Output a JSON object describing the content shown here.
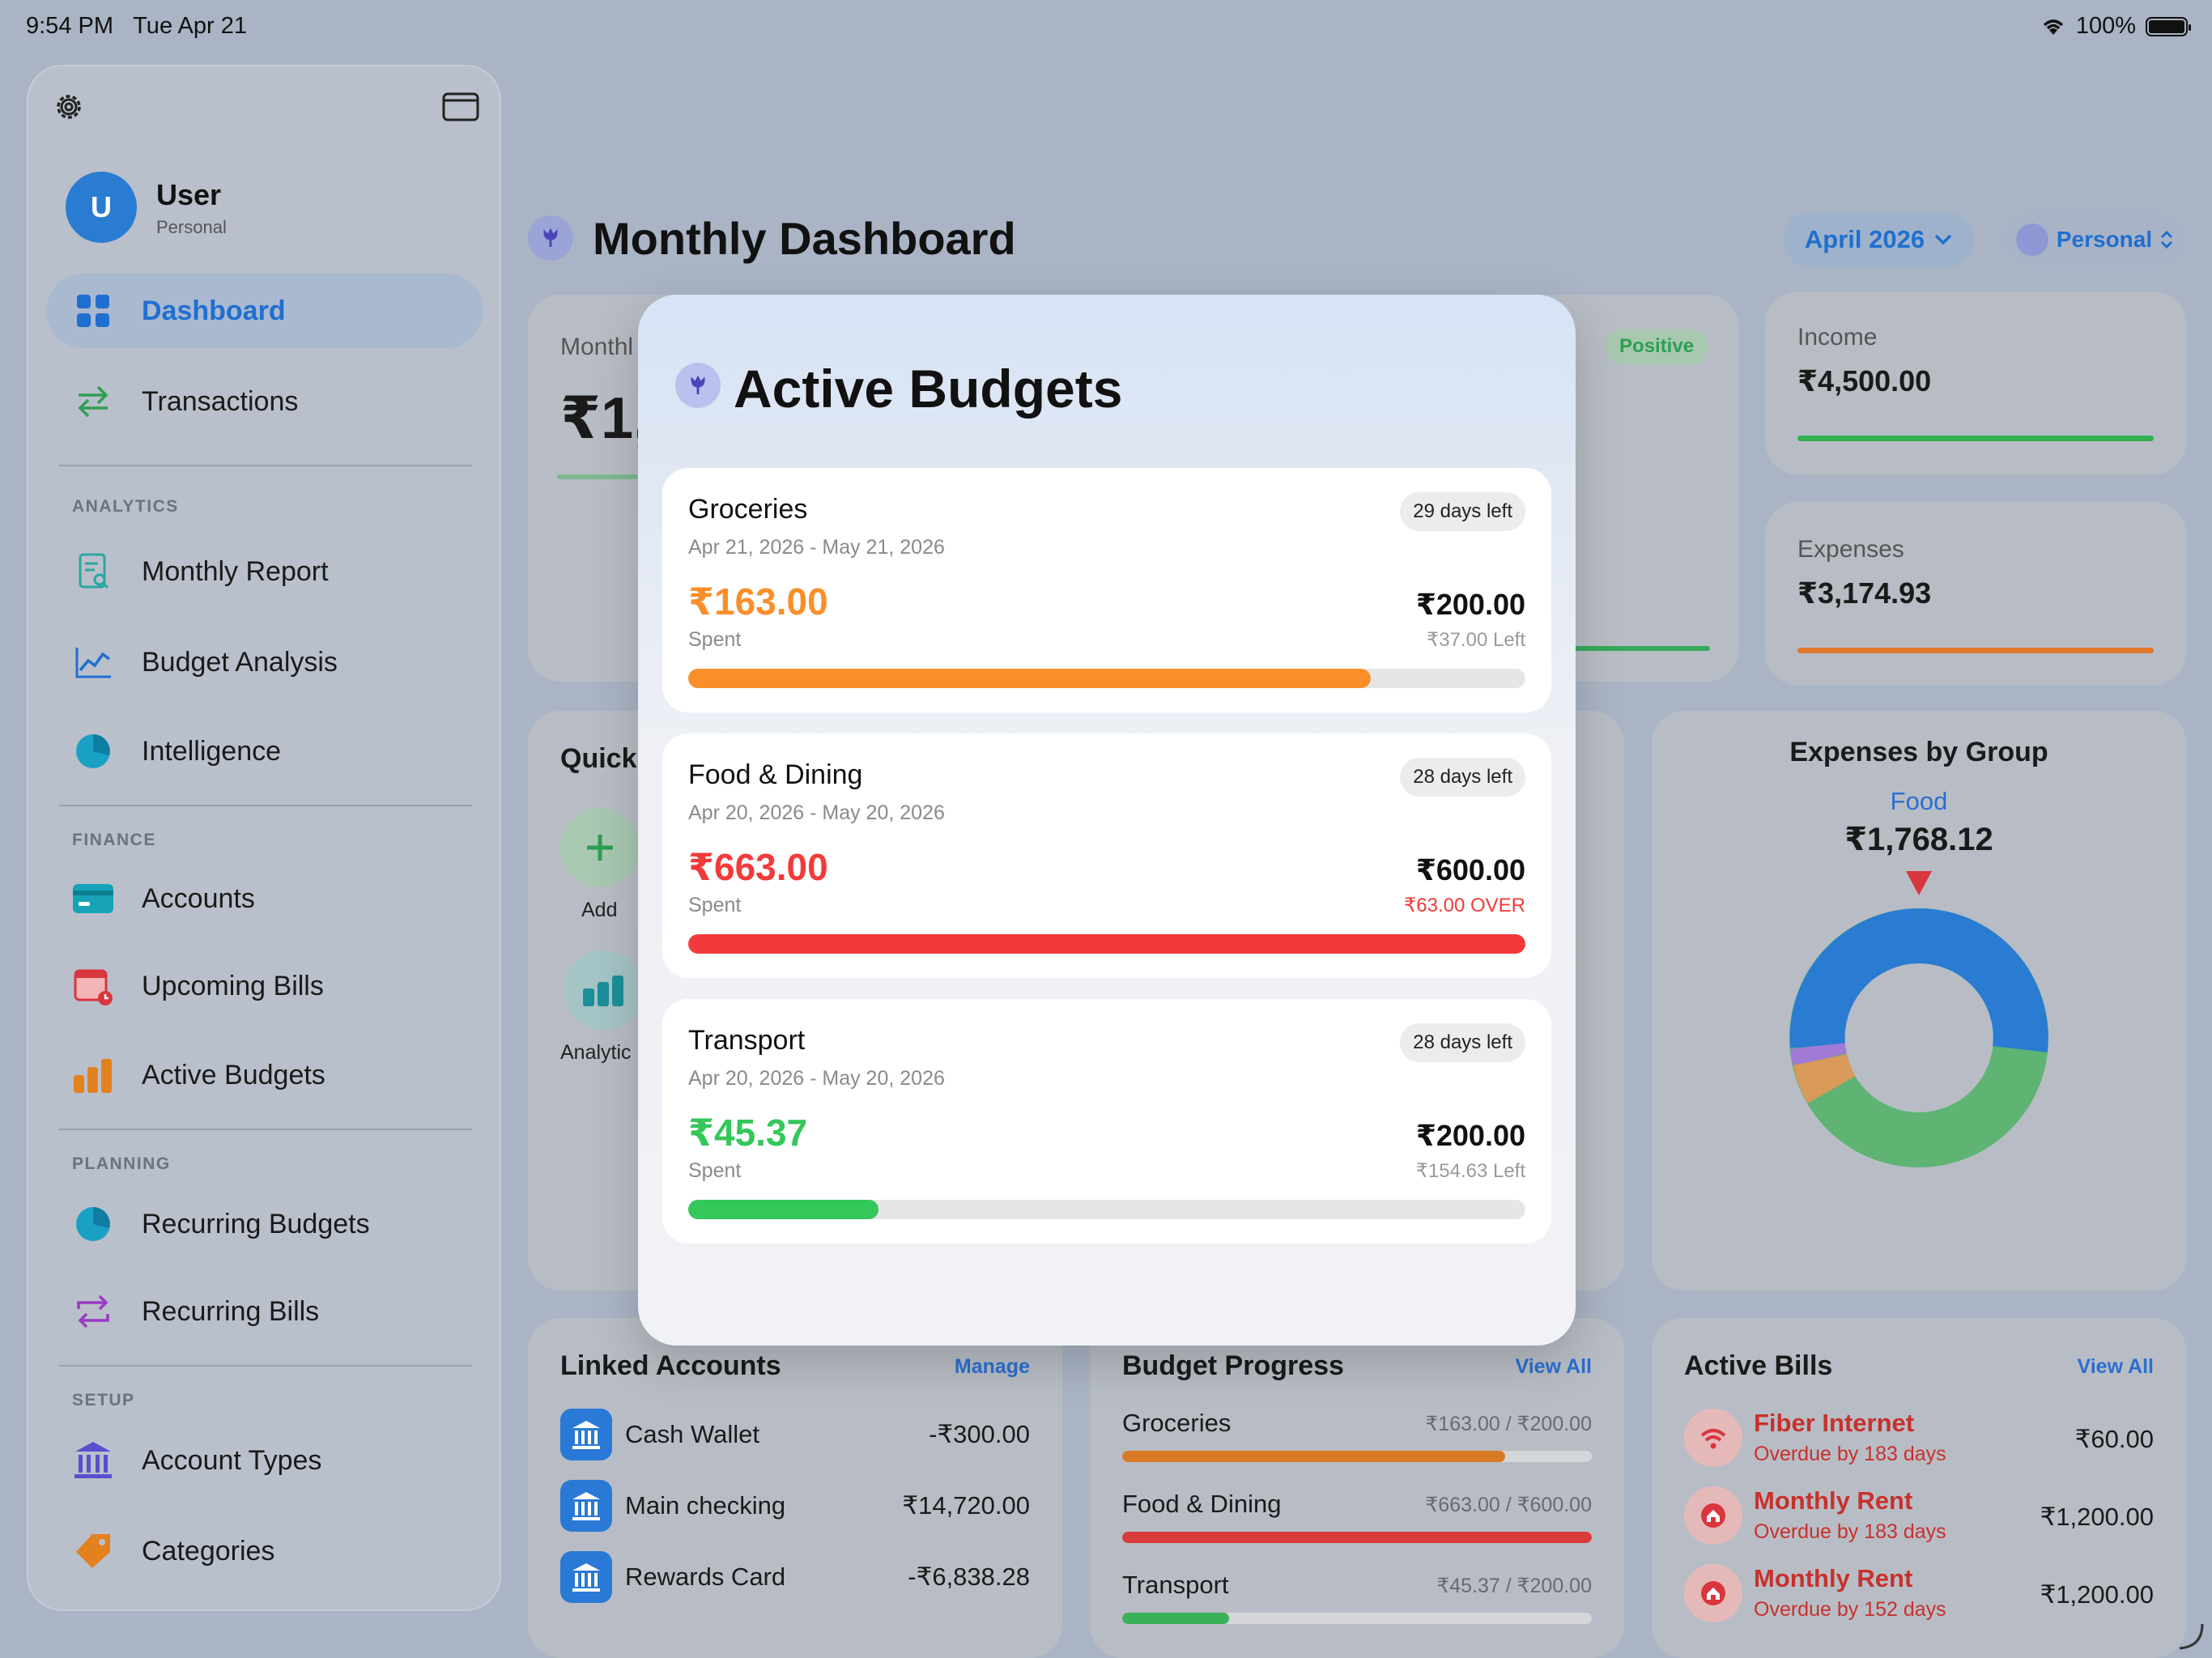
{
  "status": {
    "time": "9:54 PM",
    "date": "Tue Apr 21",
    "battery": "100%"
  },
  "sidebar": {
    "user": {
      "initial": "U",
      "name": "User",
      "profile": "Personal"
    },
    "items": [
      {
        "label": "Dashboard",
        "icon": "grid-icon",
        "active": true
      },
      {
        "label": "Transactions",
        "icon": "arrows-swap-icon"
      }
    ],
    "analytics_label": "ANALYTICS",
    "analytics": [
      {
        "label": "Monthly Report",
        "icon": "report-icon"
      },
      {
        "label": "Budget Analysis",
        "icon": "line-chart-icon"
      },
      {
        "label": "Intelligence",
        "icon": "pie-chart-icon"
      }
    ],
    "finance_label": "FINANCE",
    "finance": [
      {
        "label": "Accounts",
        "icon": "credit-card-icon"
      },
      {
        "label": "Upcoming Bills",
        "icon": "calendar-icon"
      },
      {
        "label": "Active Budgets",
        "icon": "bar-chart-icon"
      }
    ],
    "planning_label": "PLANNING",
    "planning": [
      {
        "label": "Recurring Budgets",
        "icon": "pie-chart-icon"
      },
      {
        "label": "Recurring Bills",
        "icon": "repeat-icon"
      }
    ],
    "setup_label": "SETUP",
    "setup": [
      {
        "label": "Account Types",
        "icon": "bank-icon"
      },
      {
        "label": "Categories",
        "icon": "tag-icon"
      }
    ]
  },
  "header": {
    "title": "Monthly Dashboard",
    "month": "April 2026",
    "profile": "Personal"
  },
  "summary": {
    "monthly_label": "Monthl",
    "monthly_value": "₹1,",
    "positive_badge": "Positive",
    "income_label": "Income",
    "income_value": "₹4,500.00",
    "expenses_label": "Expenses",
    "expenses_value": "₹3,174.93"
  },
  "quick": {
    "title": "Quick",
    "add_label": "Add",
    "analytics_label": "Analytic"
  },
  "expenses_group": {
    "title": "Expenses by Group",
    "selected_group": "Food",
    "selected_value": "₹1,768.12",
    "colors": {
      "food": "#2a7cd2",
      "green": "#5fb373",
      "orange": "#d99a5a",
      "purple": "#a07ad6"
    }
  },
  "modal": {
    "title": "Active Budgets",
    "budgets": [
      {
        "name": "Groceries",
        "dates": "Apr 21, 2026 - May 21, 2026",
        "days_left": "29 days left",
        "spent": "₹163.00",
        "spent_label": "Spent",
        "limit": "₹200.00",
        "remaining": "₹37.00 Left",
        "progress": 0.815,
        "color": "#fa8f2a"
      },
      {
        "name": "Food & Dining",
        "dates": "Apr 20, 2026 - May 20, 2026",
        "days_left": "28 days left",
        "spent": "₹663.00",
        "spent_label": "Spent",
        "limit": "₹600.00",
        "remaining": "₹63.00 OVER",
        "progress": 1.0,
        "color": "#f23a3a"
      },
      {
        "name": "Transport",
        "dates": "Apr 20, 2026 - May 20, 2026",
        "days_left": "28 days left",
        "spent": "₹45.37",
        "spent_label": "Spent",
        "limit": "₹200.00",
        "remaining": "₹154.63 Left",
        "progress": 0.227,
        "color": "#34c759"
      }
    ]
  },
  "linked_accounts": {
    "title": "Linked Accounts",
    "action": "Manage",
    "rows": [
      {
        "name": "Cash Wallet",
        "amount": "-₹300.00"
      },
      {
        "name": "Main checking",
        "amount": "₹14,720.00"
      },
      {
        "name": "Rewards Card",
        "amount": "-₹6,838.28"
      }
    ]
  },
  "budget_progress": {
    "title": "Budget Progress",
    "action": "View All",
    "rows": [
      {
        "name": "Groceries",
        "amounts": "₹163.00 / ₹200.00",
        "progress": 0.815,
        "color": "#d97a24"
      },
      {
        "name": "Food & Dining",
        "amounts": "₹663.00 / ₹600.00",
        "progress": 1.0,
        "color": "#d93b3b"
      },
      {
        "name": "Transport",
        "amounts": "₹45.37 / ₹200.00",
        "progress": 0.227,
        "color": "#3bb05a"
      }
    ]
  },
  "active_bills": {
    "title": "Active Bills",
    "action": "View All",
    "rows": [
      {
        "name": "Fiber Internet",
        "status": "Overdue by 183 days",
        "amount": "₹60.00",
        "icon": "wifi-icon"
      },
      {
        "name": "Monthly Rent",
        "status": "Overdue by 183 days",
        "amount": "₹1,200.00",
        "icon": "house-icon"
      },
      {
        "name": "Monthly Rent",
        "status": "Overdue by 152 days",
        "amount": "₹1,200.00",
        "icon": "house-icon"
      }
    ]
  }
}
